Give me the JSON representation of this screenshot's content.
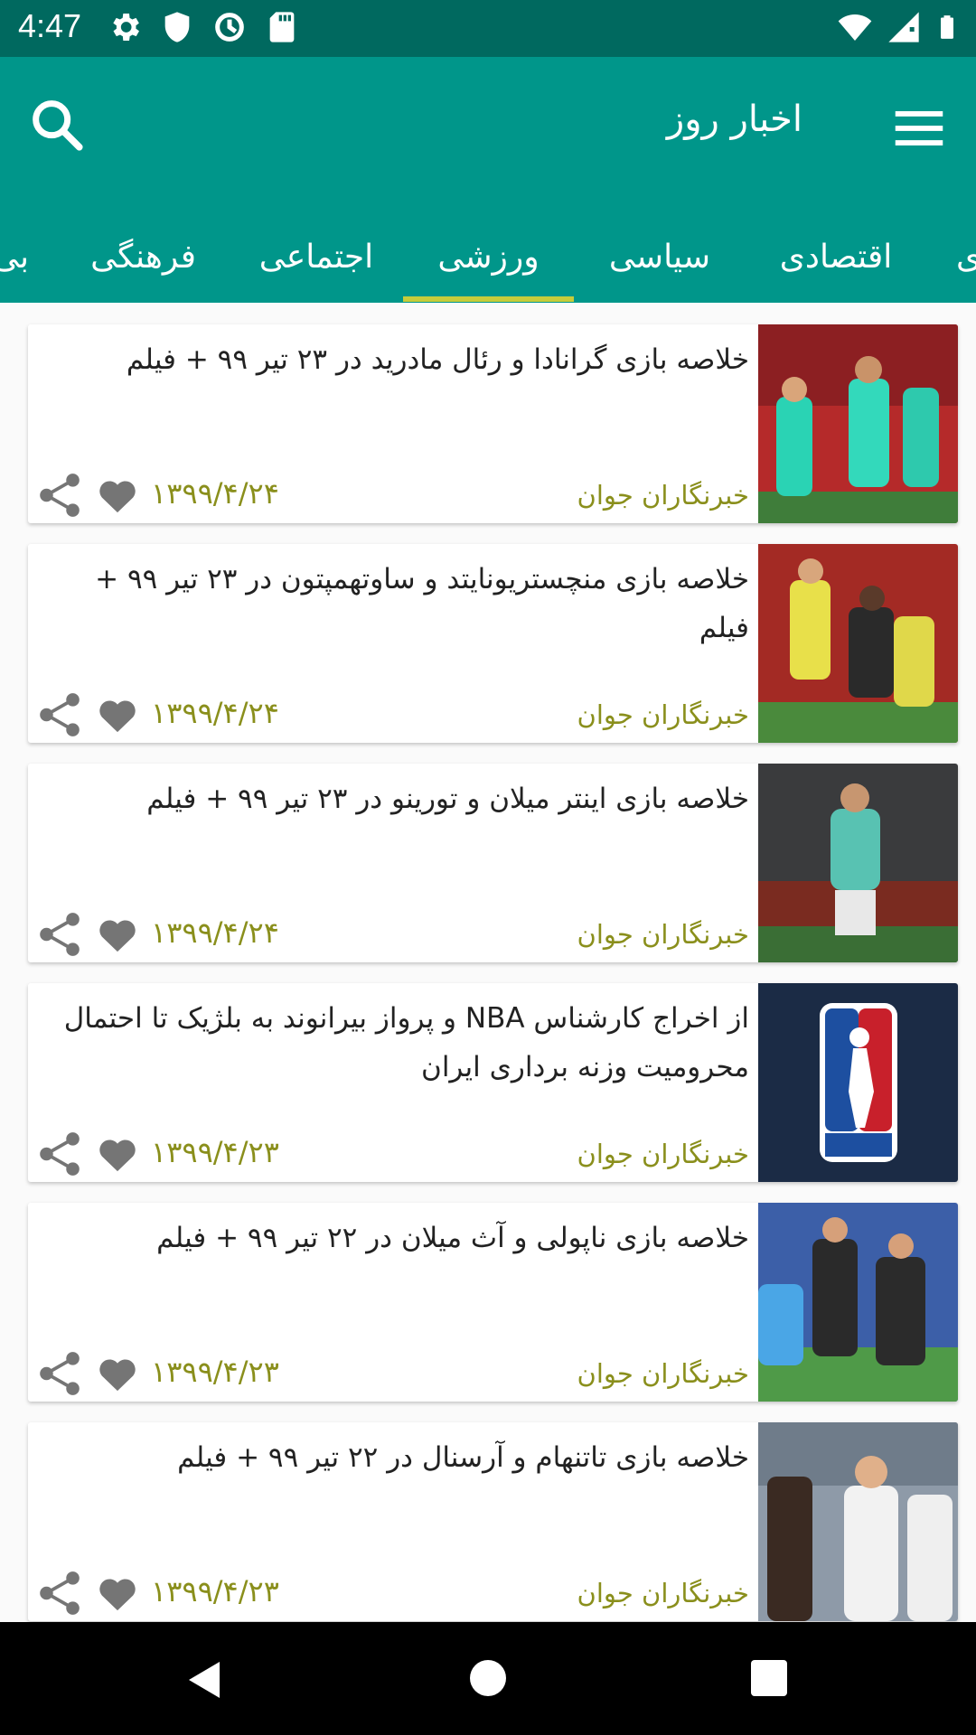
{
  "status_bar": {
    "time": "4:47",
    "icons_left": [
      "settings-icon",
      "shield-icon",
      "data-saver-icon",
      "sd-card-icon"
    ],
    "icons_right": [
      "wifi-icon",
      "signal-icon",
      "battery-icon"
    ]
  },
  "app_bar": {
    "title": "اخبار روز",
    "search_icon": "search-icon",
    "menu_icon": "menu-icon",
    "background": "#00968a"
  },
  "tabs": [
    {
      "label": "ی"
    },
    {
      "label": "اقتصادی"
    },
    {
      "label": "سیاسی"
    },
    {
      "label": "ورزشی",
      "selected": true
    },
    {
      "label": "اجتماعی"
    },
    {
      "label": "فرهنگی"
    },
    {
      "label": "بی"
    }
  ],
  "colors": {
    "accent_indicator": "#c6cc3a",
    "source_text": "#8a8f1c",
    "status_bar": "#00695f",
    "heart": "#757575"
  },
  "articles": [
    {
      "title": "خلاصه بازی گرانادا و رئال مادرید در ۲۳ تیر ۹۹ + فیلم",
      "source": "خبرنگاران جوان",
      "date": "۱۳۹۹/۴/۲۴"
    },
    {
      "title": "خلاصه بازی منچستریونایتد و ساوتهمپتون در ۲۳ تیر ۹۹ + فیلم",
      "source": "خبرنگاران جوان",
      "date": "۱۳۹۹/۴/۲۴"
    },
    {
      "title": "خلاصه بازی اینتر میلان و تورینو در ۲۳ تیر ۹۹ + فیلم",
      "source": "خبرنگاران جوان",
      "date": "۱۳۹۹/۴/۲۴"
    },
    {
      "title": "از اخراج کارشناس NBA و پرواز بیرانوند به بلژیک تا احتمال محرومیت وزنه برداری ایران",
      "source": "خبرنگاران جوان",
      "date": "۱۳۹۹/۴/۲۳"
    },
    {
      "title": "خلاصه بازی ناپولی و آث میلان در ۲۲ تیر ۹۹ + فیلم",
      "source": "خبرنگاران جوان",
      "date": "۱۳۹۹/۴/۲۳"
    },
    {
      "title": "خلاصه بازی تاتنهام و آرسنال در ۲۲ تیر ۹۹ + فیلم",
      "source": "خبرنگاران جوان",
      "date": "۱۳۹۹/۴/۲۳"
    }
  ],
  "nav_bar": {
    "back_icon": "back-icon",
    "home_icon": "home-icon",
    "recents_icon": "recents-icon"
  }
}
